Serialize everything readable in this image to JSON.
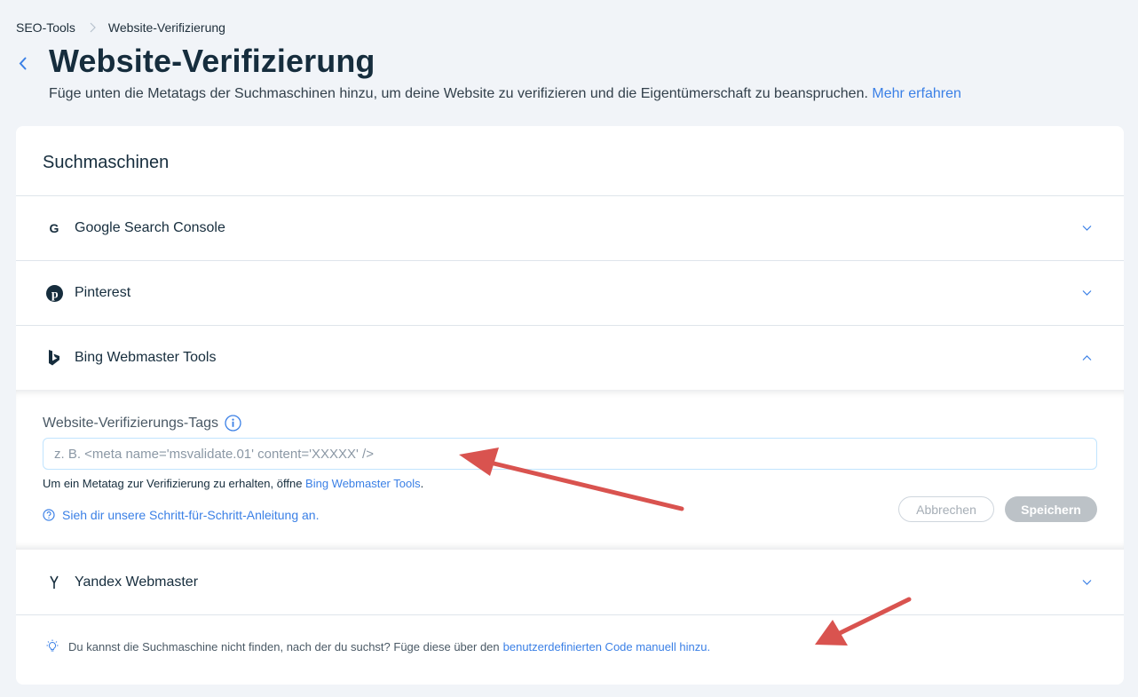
{
  "breadcrumb": {
    "parent": "SEO-Tools",
    "current": "Website-Verifizierung"
  },
  "header": {
    "title": "Website-Verifizierung",
    "description": "Füge unten die Metatags der Suchmaschinen hinzu, um deine Website zu verifizieren und die Eigentümerschaft zu beanspruchen.",
    "learn_more": "Mehr erfahren"
  },
  "card": {
    "title": "Suchmaschinen",
    "engines": [
      {
        "label": "Google Search Console",
        "icon": "google-icon",
        "expanded": false
      },
      {
        "label": "Pinterest",
        "icon": "pinterest-icon",
        "expanded": false
      },
      {
        "label": "Bing Webmaster Tools",
        "icon": "bing-icon",
        "expanded": true
      },
      {
        "label": "Yandex Webmaster",
        "icon": "yandex-icon",
        "expanded": false
      }
    ],
    "bing_panel": {
      "field_label": "Website-Verifizierungs-Tags",
      "input_value": "",
      "input_placeholder": "z. B. <meta name='msvalidate.01' content='XXXXX' />",
      "hint_prefix": "Um ein Metatag zur Verifizierung zu erhalten, öffne ",
      "hint_link": "Bing Webmaster Tools",
      "hint_suffix": ".",
      "guide_link": "Sieh dir unsere Schritt-für-Schritt-Anleitung an.",
      "cancel_label": "Abbrechen",
      "save_label": "Speichern"
    },
    "footer": {
      "text": "Du kannst die Suchmaschine nicht finden, nach der du suchst? Füge diese über den ",
      "link": "benutzerdefinierten Code manuell hinzu."
    }
  },
  "colors": {
    "accent": "#3b80e6",
    "background": "#f1f4f8",
    "annotation_arrow": "#d9534f"
  }
}
